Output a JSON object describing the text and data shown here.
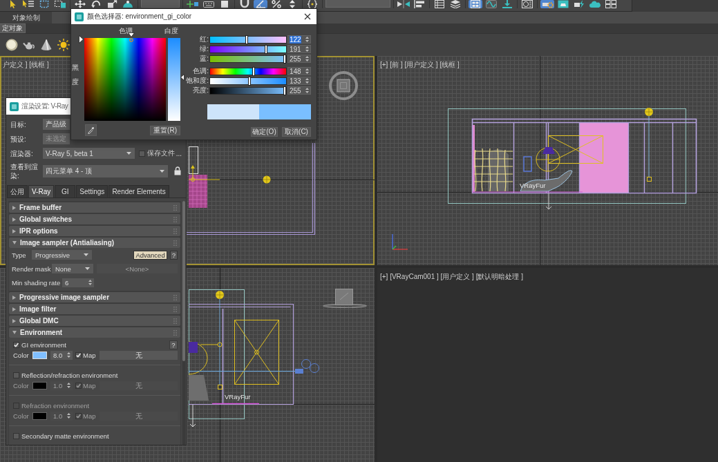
{
  "toolbar": {
    "groups": [
      {
        "kind": "tools",
        "tools": [
          {
            "kind": "cursor",
            "selected": false
          },
          {
            "kind": "select_list",
            "selected": false
          },
          {
            "kind": "rect_region",
            "selected": false
          },
          {
            "kind": "window_crossing",
            "selected": false
          }
        ]
      },
      {
        "kind": "tools",
        "tools": [
          {
            "kind": "move",
            "selected": false
          },
          {
            "kind": "rotate",
            "selected": false
          },
          {
            "kind": "scale",
            "selected": false
          },
          {
            "kind": "placement",
            "selected": false
          }
        ]
      },
      {
        "kind": "dropdown"
      },
      {
        "kind": "tools",
        "tools": [
          {
            "kind": "pivot",
            "selected": false
          },
          {
            "kind": "keyboard",
            "selected": false
          },
          {
            "kind": "square",
            "selected": false
          }
        ]
      },
      {
        "kind": "tools",
        "tools": [
          {
            "kind": "snap",
            "selected": false
          },
          {
            "kind": "angle_snap",
            "selected": true
          },
          {
            "kind": "percent_snap",
            "selected": false
          },
          {
            "kind": "spinner_snap",
            "selected": false
          }
        ]
      },
      {
        "kind": "tools",
        "tools": [
          {
            "kind": "braces",
            "selected": false
          }
        ]
      },
      {
        "kind": "wide_dropdown"
      },
      {
        "kind": "tools",
        "tools": [
          {
            "kind": "mirror",
            "selected": false
          },
          {
            "kind": "align",
            "selected": false
          }
        ]
      },
      {
        "kind": "tools",
        "tools": [
          {
            "kind": "list",
            "selected": false
          },
          {
            "kind": "layers",
            "selected": false
          }
        ]
      },
      {
        "kind": "tools",
        "tools": [
          {
            "kind": "graph",
            "selected": true
          },
          {
            "kind": "curve",
            "selected": false
          },
          {
            "kind": "download",
            "selected": false
          }
        ]
      },
      {
        "kind": "tools",
        "tools": [
          {
            "kind": "material",
            "selected": false
          }
        ]
      },
      {
        "kind": "tools",
        "tools": [
          {
            "kind": "render_setup",
            "selected": true
          },
          {
            "kind": "render_frame",
            "selected": false
          },
          {
            "kind": "render",
            "selected": false
          },
          {
            "kind": "cloud",
            "selected": false
          },
          {
            "kind": "grid",
            "selected": false
          }
        ]
      }
    ]
  },
  "ribbon": {
    "tab": "对象绘制",
    "button": "定对象",
    "create_icons": [
      {
        "kind": "sphere"
      },
      {
        "kind": "teapot"
      },
      {
        "kind": "cone"
      },
      {
        "kind": "sun"
      }
    ]
  },
  "viewports": [
    {
      "kind": "plan",
      "label": "户定义 ] [线框 ]",
      "active": true
    },
    {
      "kind": "front",
      "label": "[+] [前 ] [用户定义 ] [线框 ]",
      "active": false,
      "object_labels": [
        "VRayFur"
      ]
    },
    {
      "kind": "side",
      "active": false,
      "object_labels": [
        "VRayFur"
      ]
    },
    {
      "kind": "camera",
      "label": "[+] [VRayCam001 ] [用户定义 ] [默认明暗处理 ]",
      "active": false
    }
  ],
  "render_setup": {
    "title": "渲染设置: V-Ray",
    "rows": [
      {
        "kind": "clipped",
        "label": "目标:",
        "value": "产品级",
        "disabled": false
      },
      {
        "kind": "clipped",
        "label": "预设:",
        "value": "未选定",
        "disabled": true
      },
      {
        "kind": "renderer",
        "label": "渲染器:",
        "value": "V-Ray 5, beta 1",
        "disabled": false,
        "option": {
          "label": "保存文件",
          "checked": false
        },
        "more": "..."
      },
      {
        "kind": "locked",
        "label": "查看到渲染:",
        "value": "四元菜单 4 - 顶",
        "disabled": false
      }
    ],
    "tabs": [
      {
        "label": "公用",
        "selected": false
      },
      {
        "label": "V-Ray",
        "selected": true
      },
      {
        "label": "GI",
        "selected": false
      },
      {
        "label": "Settings",
        "selected": false
      },
      {
        "label": "Render Elements",
        "selected": false
      }
    ],
    "rollouts": [
      {
        "title": "Frame buffer",
        "expanded": false
      },
      {
        "title": "Global switches",
        "expanded": false
      },
      {
        "title": "IPR options",
        "expanded": false
      },
      {
        "title": "Image sampler (Antialiasing)",
        "expanded": true,
        "rows": [
          {
            "kind": "dropdown_buttons",
            "label": "Type",
            "value": "Progressive",
            "buttons": [
              {
                "label": "Advanced",
                "on": true
              },
              {
                "label": "?",
                "on": false
              }
            ]
          },
          {
            "kind": "dropdown_field",
            "label": "Render mask",
            "value": "None",
            "field": {
              "text": "<None>",
              "disabled": true
            }
          },
          {
            "kind": "spinner",
            "label": "Min shading rate",
            "value": "6"
          }
        ]
      },
      {
        "title": "Progressive image sampler",
        "expanded": false
      },
      {
        "title": "Image filter",
        "expanded": false
      },
      {
        "title": "Global DMC",
        "expanded": false
      },
      {
        "title": "Environment",
        "expanded": true,
        "groups": [
          {
            "label": "GI environment",
            "checked": true,
            "disabled": false,
            "help": "?",
            "color_label": "Color",
            "color": "#80bfff",
            "multiplier": "8.0",
            "map_label": "Map",
            "map_checked": true,
            "map": "无"
          },
          {
            "label": "Reflection/refraction environment",
            "checked": false,
            "disabled": false,
            "color_label": "Color",
            "color": "#000000",
            "multiplier": "1.0",
            "map_label": "Map",
            "map_checked": true,
            "map": "无"
          },
          {
            "label": "Refraction environment",
            "checked": false,
            "disabled": true,
            "color_label": "Color",
            "color": "#000000",
            "multiplier": "1.0",
            "map_label": "Map",
            "map_checked": true,
            "map": "无"
          },
          {
            "label": "Secondary matte environment",
            "checked": false,
            "disabled": false
          }
        ]
      }
    ]
  },
  "color_picker": {
    "title": "颜色选择器: environment_gi_color",
    "hue_label": "色调",
    "whiteness_label": "白度",
    "blackness_label": "黑度",
    "sliders": [
      {
        "kind": "red",
        "label": "红:",
        "value": "122",
        "level": 0.478,
        "highlighted": true
      },
      {
        "kind": "green",
        "label": "绿:",
        "value": "191",
        "level": 0.749,
        "highlighted": false
      },
      {
        "kind": "blue",
        "label": "蓝:",
        "value": "255",
        "level": 1,
        "highlighted": false
      },
      {
        "kind": "hue",
        "label": "色调:",
        "value": "148",
        "level": 0.58,
        "highlighted": false
      },
      {
        "kind": "saturation",
        "label": "饱和度:",
        "value": "133",
        "level": 0.522,
        "highlighted": false
      },
      {
        "kind": "value",
        "label": "亮度:",
        "value": "255",
        "level": 1,
        "highlighted": false
      }
    ],
    "swatches": [
      {
        "color": "#cde4fb"
      },
      {
        "color": "#7abfff"
      }
    ],
    "reset_button": "重置(R)",
    "ok_button": "确定(O)",
    "cancel_button": "取消(C)"
  }
}
